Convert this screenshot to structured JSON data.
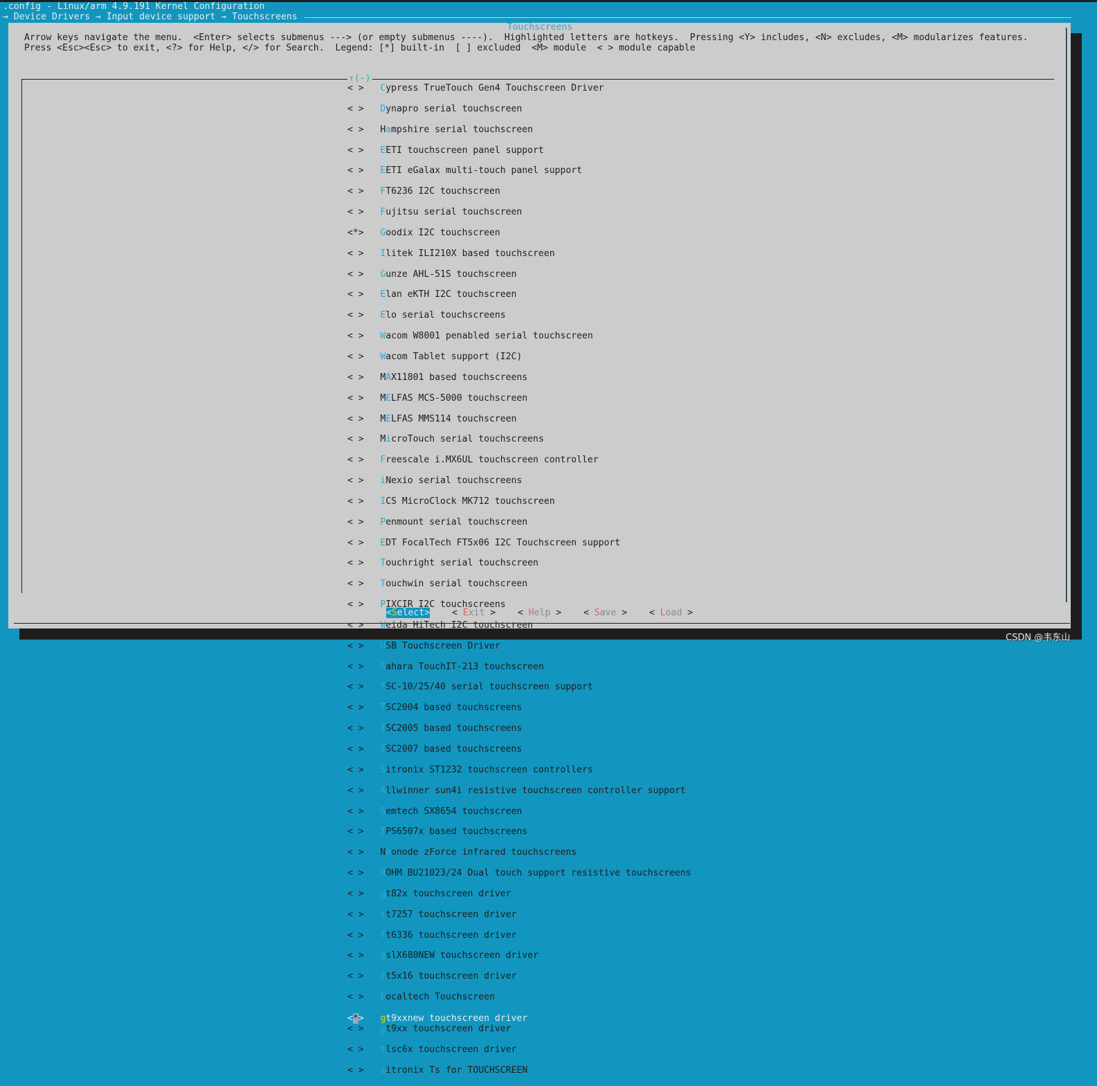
{
  "window": {
    "title": ".config - Linux/arm 4.9.191 Kernel Configuration",
    "breadcrumb": "→ Device Drivers → Input device support → Touchscreens"
  },
  "dialog": {
    "title": "Touchscreens",
    "help_line1": "Arrow keys navigate the menu.  <Enter> selects submenus ---> (or empty submenus ----).  Highlighted letters are hotkeys.  Pressing <Y> includes, <N> excludes, <M> modularizes features.",
    "help_line2": "Press <Esc><Esc> to exit, <?> for Help, </> for Search.  Legend: [*] built-in  [ ] excluded  <M> module  < > module capable",
    "scroll_indicator": "↑(-)"
  },
  "menu": {
    "selected_index": 45,
    "items": [
      {
        "state": "< >",
        "label": "Cypress TrueTouch Gen4 Touchscreen Driver",
        "hotkey": 0
      },
      {
        "state": "< >",
        "label": "Dynapro serial touchscreen",
        "hotkey": 0
      },
      {
        "state": "< >",
        "label": "Hampshire serial touchscreen",
        "hotkey": 1
      },
      {
        "state": "< >",
        "label": "EETI touchscreen panel support",
        "hotkey": 0
      },
      {
        "state": "< >",
        "label": "EETI eGalax multi-touch panel support",
        "hotkey": 0
      },
      {
        "state": "< >",
        "label": "FT6236 I2C touchscreen",
        "hotkey": 0
      },
      {
        "state": "< >",
        "label": "Fujitsu serial touchscreen",
        "hotkey": 0
      },
      {
        "state": "<*>",
        "label": "Goodix I2C touchscreen",
        "hotkey": 0
      },
      {
        "state": "< >",
        "label": "Ilitek ILI210X based touchscreen",
        "hotkey": 0
      },
      {
        "state": "< >",
        "label": "Gunze AHL-51S touchscreen",
        "hotkey": 0
      },
      {
        "state": "< >",
        "label": "Elan eKTH I2C touchscreen",
        "hotkey": 0
      },
      {
        "state": "< >",
        "label": "Elo serial touchscreens",
        "hotkey": 0
      },
      {
        "state": "< >",
        "label": "Wacom W8001 penabled serial touchscreen",
        "hotkey": 0
      },
      {
        "state": "< >",
        "label": "Wacom Tablet support (I2C)",
        "hotkey": 0
      },
      {
        "state": "< >",
        "label": "MAX11801 based touchscreens",
        "hotkey": 1
      },
      {
        "state": "< >",
        "label": "MELFAS MCS-5000 touchscreen",
        "hotkey": 1
      },
      {
        "state": "< >",
        "label": "MELFAS MMS114 touchscreen",
        "hotkey": 1
      },
      {
        "state": "< >",
        "label": "MicroTouch serial touchscreens",
        "hotkey": 1
      },
      {
        "state": "< >",
        "label": "Freescale i.MX6UL touchscreen controller",
        "hotkey": 0
      },
      {
        "state": "< >",
        "label": "iNexio serial touchscreens",
        "hotkey": 0
      },
      {
        "state": "< >",
        "label": "ICS MicroClock MK712 touchscreen",
        "hotkey": 0
      },
      {
        "state": "< >",
        "label": "Penmount serial touchscreen",
        "hotkey": 0
      },
      {
        "state": "< >",
        "label": "EDT FocalTech FT5x06 I2C Touchscreen support",
        "hotkey": 0
      },
      {
        "state": "< >",
        "label": "Touchright serial touchscreen",
        "hotkey": 0
      },
      {
        "state": "< >",
        "label": "Touchwin serial touchscreen",
        "hotkey": 0
      },
      {
        "state": "< >",
        "label": "PIXCIR I2C touchscreens",
        "hotkey": 0
      },
      {
        "state": "< >",
        "label": "Weida HiTech I2C touchscreen",
        "hotkey": 0
      },
      {
        "state": "< >",
        "label": "USB Touchscreen Driver",
        "hotkey": 0
      },
      {
        "state": "< >",
        "label": "Sahara TouchIT-213 touchscreen",
        "hotkey": 0
      },
      {
        "state": "< >",
        "label": "TSC-10/25/40 serial touchscreen support",
        "hotkey": 0
      },
      {
        "state": "< >",
        "label": "TSC2004 based touchscreens",
        "hotkey": 0
      },
      {
        "state": "< >",
        "label": "TSC2005 based touchscreens",
        "hotkey": 0
      },
      {
        "state": "< >",
        "label": "TSC2007 based touchscreens",
        "hotkey": 0
      },
      {
        "state": "< >",
        "label": "Sitronix ST1232 touchscreen controllers",
        "hotkey": 0
      },
      {
        "state": "< >",
        "label": "Allwinner sun4i resistive touchscreen controller support",
        "hotkey": 0
      },
      {
        "state": "< >",
        "label": "Semtech SX8654 touchscreen",
        "hotkey": 0
      },
      {
        "state": "< >",
        "label": "TPS6507x based touchscreens",
        "hotkey": 0
      },
      {
        "state": "< >",
        "label": "Neonode zForce infrared touchscreens",
        "hotkey": 1
      },
      {
        "state": "< >",
        "label": "ROHM BU21023/24 Dual touch support resistive touchscreens",
        "hotkey": 0
      },
      {
        "state": "< >",
        "label": "gt82x touchscreen driver",
        "hotkey": 0
      },
      {
        "state": "< >",
        "label": "it7257 touchscreen driver",
        "hotkey": 0
      },
      {
        "state": "< >",
        "label": "ft6336 touchscreen driver",
        "hotkey": 0
      },
      {
        "state": "< >",
        "label": "gslX680NEW touchscreen driver",
        "hotkey": 0
      },
      {
        "state": "< >",
        "label": "ft5x16 touchscreen driver",
        "hotkey": 0
      },
      {
        "state": "< >",
        "label": "Focaltech Touchscreen",
        "hotkey": 0
      },
      {
        "state": "<*>",
        "label": "gt9xxnew touchscreen driver",
        "hotkey": 0
      },
      {
        "state": "< >",
        "label": "gt9xx touchscreen driver",
        "hotkey": 0
      },
      {
        "state": "< >",
        "label": "tlsc6x touchscreen driver",
        "hotkey": 0
      },
      {
        "state": "< >",
        "label": "sitronix Ts for TOUCHSCREEN",
        "hotkey": 0
      }
    ]
  },
  "buttons": [
    {
      "label": "Select",
      "selected": true
    },
    {
      "label": "Exit",
      "selected": false
    },
    {
      "label": "Help",
      "selected": false
    },
    {
      "label": "Save",
      "selected": false
    },
    {
      "label": "Load",
      "selected": false
    }
  ],
  "watermark": "CSDN @韦东山",
  "colors": {
    "background": "#1296c0",
    "dialog": "#cccccc",
    "hotkey": "#2aa8d8",
    "button_hotkey": "#e06060",
    "selected_hotkey": "#d8d800",
    "scroll_indicator": "#22c070"
  }
}
